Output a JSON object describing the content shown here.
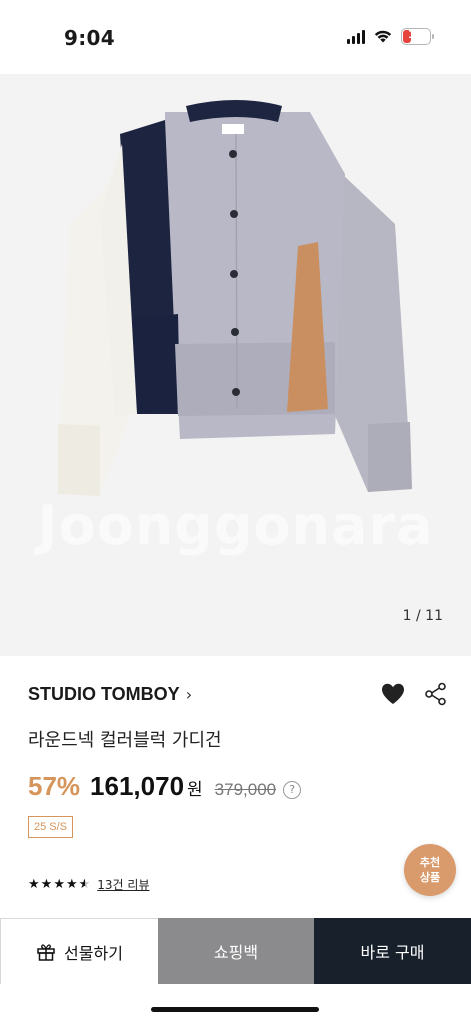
{
  "status_bar": {
    "time": "9:04",
    "battery": "17"
  },
  "product": {
    "watermark": "Joonggonara",
    "image_counter": "1 / 11",
    "image_icon": "cardigan-image",
    "brand": "STUDIO TOMBOY",
    "brand_chevron": "›",
    "title": "라운드넥 컬러블럭 가디건",
    "discount": "57%",
    "sale_price": "161,070",
    "currency": "원",
    "original_price": "379,000",
    "info_icon_label": "?",
    "season_badge": "25 S/S",
    "rating": 4.5,
    "review_link": "13건 리뷰",
    "recommend_label": "추천\n상품",
    "recommend_line1": "추천",
    "recommend_line2": "상품"
  },
  "actions": {
    "gift": "선물하기",
    "cart": "쇼핑백",
    "buy": "바로 구매"
  },
  "colors": {
    "accent": "#d6955a",
    "buy_button": "#18202b",
    "cart_button": "#8b8b8d"
  }
}
